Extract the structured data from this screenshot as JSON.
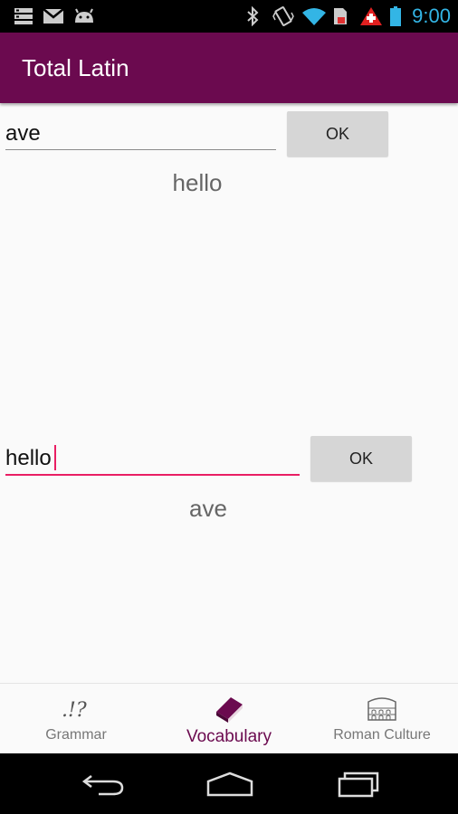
{
  "status_bar": {
    "time": "9:00",
    "time_color": "#33b5e5",
    "icons": [
      "storage-icon",
      "gmail-icon",
      "android-icon",
      "bluetooth-icon",
      "vibrate-icon",
      "wifi-icon",
      "sim-icon",
      "alert-icon",
      "battery-icon"
    ]
  },
  "app_bar": {
    "title": "Total Latin",
    "color": "#6b0a4f"
  },
  "latin_to_english": {
    "input_value": "ave",
    "button_label": "OK",
    "result": "hello"
  },
  "english_to_latin": {
    "input_value": "hello",
    "button_label": "OK",
    "result": "ave",
    "focus_color": "#e91e63"
  },
  "bottom_nav": {
    "items": [
      {
        "label": "Grammar",
        "icon": "grammar-icon",
        "active": false
      },
      {
        "label": "Vocabulary",
        "icon": "book-icon",
        "active": true
      },
      {
        "label": "Roman Culture",
        "icon": "colosseum-icon",
        "active": false
      }
    ],
    "active_color": "#6b0a4f"
  },
  "system_nav": {
    "buttons": [
      "back-icon",
      "home-icon",
      "recents-icon"
    ]
  }
}
